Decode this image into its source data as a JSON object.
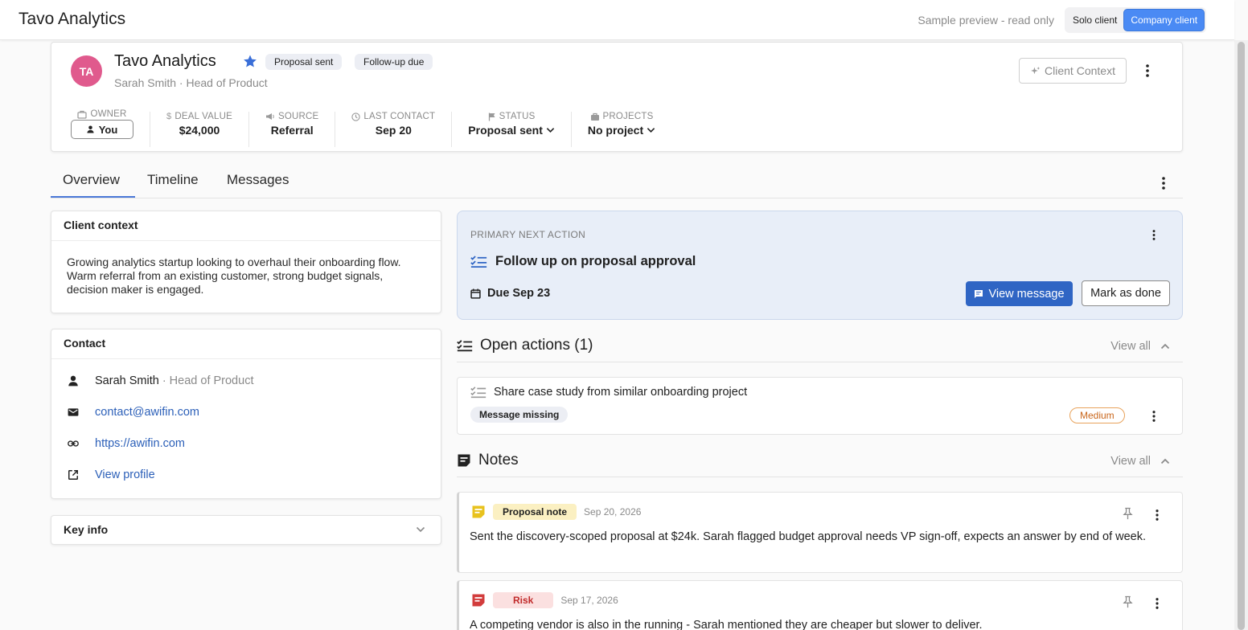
{
  "app": {
    "title": "Tavo Analytics",
    "preview_text": "Sample preview - read only",
    "segment": {
      "options": [
        "Solo client",
        "Company client"
      ],
      "active": "Company client"
    }
  },
  "client": {
    "initials": "TA",
    "name": "Tavo Analytics",
    "chips": [
      "Proposal sent",
      "Follow-up due"
    ],
    "subtitle": "Sarah Smith · Head of Product",
    "context_button": "Client Context",
    "stats": {
      "owner": {
        "label": "Owner",
        "value": "You"
      },
      "deal_value": {
        "label": "Deal value",
        "value": "$24,000"
      },
      "source": {
        "label": "Source",
        "value": "Referral"
      },
      "last_contact": {
        "label": "Last contact",
        "value": "Sep 20"
      },
      "status": {
        "label": "Status",
        "value": "Proposal sent"
      },
      "projects": {
        "label": "Projects",
        "value": "No project"
      }
    }
  },
  "tabs": [
    "Overview",
    "Timeline",
    "Messages"
  ],
  "client_context": {
    "title": "Client context",
    "text": "Growing analytics startup looking to overhaul their onboarding flow. Warm referral from an existing customer, strong budget signals, decision maker is engaged."
  },
  "contact": {
    "title": "Contact",
    "name": "Sarah Smith",
    "role": " · Head of Product",
    "email": "contact@awifin.com",
    "website": "https://awifin.com",
    "profile_link": "View profile"
  },
  "key_info": {
    "title": "Key info"
  },
  "next_action": {
    "overline": "PRIMARY NEXT ACTION",
    "title": "Follow up on proposal approval",
    "due": "Due Sep 23",
    "view_message": "View message",
    "mark_done": "Mark as done"
  },
  "open_actions": {
    "title": "Open actions (1)",
    "view_all": "View all",
    "items": [
      {
        "title": "Share case study from similar onboarding project",
        "badge": "Message missing",
        "priority": "Medium"
      }
    ]
  },
  "notes": {
    "title": "Notes",
    "view_all": "View all",
    "items": [
      {
        "tag": "Proposal note",
        "date": "Sep 20, 2026",
        "text": "Sent the discovery-scoped proposal at $24k. Sarah flagged budget approval needs VP sign-off, expects an answer by end of week.",
        "tag_color": "#fbf0c2",
        "icon_color": "#e8c21e"
      },
      {
        "tag": "Risk",
        "date": "Sep 17, 2026",
        "text": "A competing vendor is also in the running - Sarah mentioned they are cheaper but slower to deliver.",
        "tag_color": "#fbe0e0",
        "icon_color": "#d23c3c"
      }
    ]
  },
  "colors": {
    "accent": "#2f65c4",
    "avatar": "#e05a8d",
    "star": "#3a6fd8"
  }
}
